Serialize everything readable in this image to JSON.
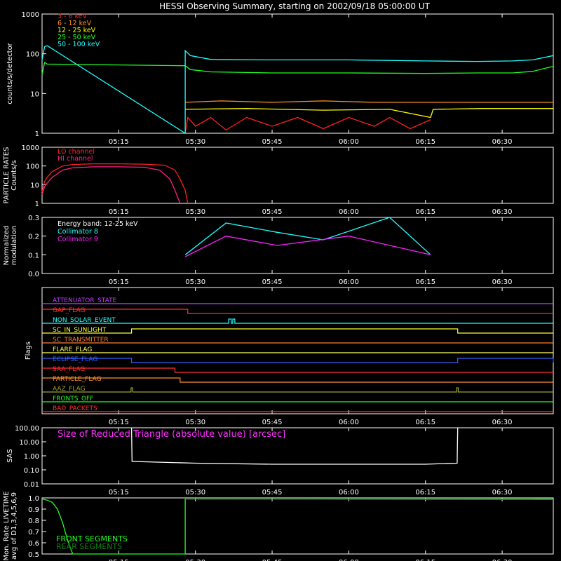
{
  "title": "HESSI Observing Summary, starting on 2002/09/18 05:00:00 UT",
  "time_axis": {
    "start_min": 0,
    "end_min": 100,
    "ticks": [
      {
        "t": 15,
        "label": "05:15"
      },
      {
        "t": 30,
        "label": "05:30"
      },
      {
        "t": 45,
        "label": "05:45"
      },
      {
        "t": 60,
        "label": "06:00"
      },
      {
        "t": 75,
        "label": "06:15"
      },
      {
        "t": 90,
        "label": "06:30"
      }
    ]
  },
  "chart_data": [
    {
      "type": "line",
      "id": "counts",
      "ylabel": "counts/s/detector",
      "yscale": "log",
      "ylim": [
        1,
        1000
      ],
      "yticks": [
        {
          "v": 1,
          "label": "1"
        },
        {
          "v": 10,
          "label": "10"
        },
        {
          "v": 100,
          "label": "100"
        },
        {
          "v": 1000,
          "label": "1000"
        }
      ],
      "series": [
        {
          "name": "3 - 6 keV",
          "color": "#ff2020",
          "points": [
            [
              28,
              1
            ],
            [
              28.5,
              2.5
            ],
            [
              30,
              1.5
            ],
            [
              33,
              2.5
            ],
            [
              36,
              1.2
            ],
            [
              40,
              2.5
            ],
            [
              45,
              1.5
            ],
            [
              50,
              2.5
            ],
            [
              55,
              1.3
            ],
            [
              60,
              2.5
            ],
            [
              65,
              1.5
            ],
            [
              68,
              2.5
            ],
            [
              72,
              1.3
            ],
            [
              76,
              2.2
            ]
          ]
        },
        {
          "name": "6 - 12 keV",
          "color": "#ff9020",
          "points": [
            [
              28,
              6
            ],
            [
              35,
              6.5
            ],
            [
              45,
              6
            ],
            [
              55,
              6.5
            ],
            [
              65,
              6
            ],
            [
              72,
              6
            ],
            [
              86,
              6
            ],
            [
              100,
              6
            ]
          ]
        },
        {
          "name": "12 - 25 keV",
          "color": "#ffff00",
          "points": [
            [
              28,
              4
            ],
            [
              40,
              4.2
            ],
            [
              55,
              3.8
            ],
            [
              68,
              4
            ],
            [
              76,
              2.5
            ],
            [
              76.5,
              4
            ],
            [
              86,
              4.2
            ],
            [
              100,
              4.2
            ]
          ]
        },
        {
          "name": "25 - 50 keV",
          "color": "#20ff20",
          "points": [
            [
              0,
              30
            ],
            [
              0.5,
              60
            ],
            [
              1,
              55
            ],
            [
              28,
              50
            ],
            [
              29,
              40
            ],
            [
              33,
              35
            ],
            [
              45,
              33
            ],
            [
              60,
              33
            ],
            [
              75,
              32
            ],
            [
              85,
              33
            ],
            [
              92,
              33
            ],
            [
              96,
              36
            ],
            [
              99,
              45
            ],
            [
              100,
              48
            ]
          ]
        },
        {
          "name": "50 - 100 keV",
          "color": "#20ffff",
          "points": [
            [
              0,
              70
            ],
            [
              0.5,
              150
            ],
            [
              1,
              160
            ],
            [
              28,
              1
            ],
            [
              28,
              120
            ],
            [
              29,
              90
            ],
            [
              33,
              72
            ],
            [
              45,
              70
            ],
            [
              60,
              70
            ],
            [
              75,
              66
            ],
            [
              85,
              64
            ],
            [
              92,
              66
            ],
            [
              96,
              70
            ],
            [
              99,
              85
            ],
            [
              100,
              90
            ]
          ]
        }
      ]
    },
    {
      "type": "line",
      "id": "particle",
      "ylabel": "PARTICLE RATES",
      "ylabel2": "Counts/s",
      "yscale": "log",
      "ylim": [
        1,
        1000
      ],
      "yticks": [
        {
          "v": 1,
          "label": "1"
        },
        {
          "v": 10,
          "label": "10"
        },
        {
          "v": 100,
          "label": "100"
        },
        {
          "v": 1000,
          "label": "1000"
        }
      ],
      "series": [
        {
          "name": "LO channel",
          "color": "#ff2020",
          "points": [
            [
              0,
              4
            ],
            [
              0.5,
              15
            ],
            [
              1,
              25
            ],
            [
              2,
              50
            ],
            [
              4,
              100
            ],
            [
              6,
              120
            ],
            [
              10,
              130
            ],
            [
              15,
              130
            ],
            [
              20,
              125
            ],
            [
              24,
              110
            ],
            [
              26,
              60
            ],
            [
              27,
              20
            ],
            [
              28,
              5
            ],
            [
              28.5,
              1
            ]
          ]
        },
        {
          "name": "HI channel",
          "color": "#ff2080",
          "points": [
            [
              0,
              3
            ],
            [
              0.5,
              8
            ],
            [
              1,
              12
            ],
            [
              2,
              25
            ],
            [
              4,
              60
            ],
            [
              6,
              80
            ],
            [
              10,
              90
            ],
            [
              15,
              90
            ],
            [
              20,
              85
            ],
            [
              23,
              60
            ],
            [
              25,
              20
            ],
            [
              26,
              5
            ],
            [
              27,
              1
            ]
          ]
        }
      ]
    },
    {
      "type": "line",
      "id": "modulation",
      "ylabel": "Normalized",
      "ylabel2": "modulation",
      "yscale": "linear",
      "ylim": [
        0,
        0.3
      ],
      "yticks": [
        {
          "v": 0,
          "label": "0.0"
        },
        {
          "v": 0.1,
          "label": "0.1"
        },
        {
          "v": 0.2,
          "label": "0.2"
        },
        {
          "v": 0.3,
          "label": "0.3"
        }
      ],
      "note": "Energy band: 12-25 keV",
      "series": [
        {
          "name": "Collimator 8",
          "color": "#20ffff",
          "points": [
            [
              28,
              0.1
            ],
            [
              36,
              0.27
            ],
            [
              46,
              0.22
            ],
            [
              55,
              0.18
            ],
            [
              68,
              0.3
            ],
            [
              76,
              0.1
            ]
          ]
        },
        {
          "name": "Collimator 9",
          "color": "#ff20ff",
          "points": [
            [
              28,
              0.09
            ],
            [
              36,
              0.2
            ],
            [
              46,
              0.15
            ],
            [
              60,
              0.2
            ],
            [
              76,
              0.1
            ]
          ]
        }
      ]
    },
    {
      "type": "line",
      "id": "sas",
      "ylabel": "SAS",
      "yscale": "log",
      "ylim": [
        0.01,
        100
      ],
      "yticks": [
        {
          "v": 0.01,
          "label": "0.01"
        },
        {
          "v": 0.1,
          "label": "0.10"
        },
        {
          "v": 1,
          "label": "1.00"
        },
        {
          "v": 10,
          "label": "10.00"
        },
        {
          "v": 100,
          "label": "100.00"
        }
      ],
      "note": "Size of Reduced Triangle (absolute value) [arcsec]",
      "series": [
        {
          "name": "",
          "color": "#ffffff",
          "points": [
            [
              17.5,
              100
            ],
            [
              17.6,
              0.4
            ],
            [
              30,
              0.3
            ],
            [
              45,
              0.25
            ],
            [
              60,
              0.25
            ],
            [
              75,
              0.25
            ],
            [
              81.2,
              0.3
            ],
            [
              81.3,
              100
            ]
          ]
        }
      ]
    },
    {
      "type": "line",
      "id": "livetime",
      "ylabel": "Mon. Rate LIVETIME",
      "ylabel2": "avg of D1,3,4,5,6,9",
      "yscale": "linear",
      "ylim": [
        0.5,
        1.0
      ],
      "yticks": [
        {
          "v": 0.5,
          "label": "0.5"
        },
        {
          "v": 0.6,
          "label": "0.6"
        },
        {
          "v": 0.7,
          "label": "0.7"
        },
        {
          "v": 0.8,
          "label": "0.8"
        },
        {
          "v": 0.9,
          "label": "0.9"
        },
        {
          "v": 1.0,
          "label": "1.0"
        }
      ],
      "series": [
        {
          "name": "FRONT SEGMENTS",
          "color": "#20ff20",
          "points": [
            [
              0,
              0.99
            ],
            [
              1,
              0.98
            ],
            [
              2,
              0.96
            ],
            [
              3,
              0.9
            ],
            [
              4,
              0.78
            ],
            [
              5,
              0.62
            ],
            [
              6,
              0.5
            ],
            [
              28,
              0.5
            ],
            [
              28,
              0.99
            ],
            [
              100,
              0.99
            ]
          ]
        },
        {
          "name": "REAR SEGMENTS",
          "color": "#108010",
          "points": [
            [
              28,
              0.99
            ],
            [
              100,
              0.985
            ]
          ]
        }
      ]
    }
  ],
  "flags": {
    "ylabel": "Flags",
    "rows": [
      {
        "name": "ATTENUATOR_STATE",
        "color": "#c040ff",
        "segments": []
      },
      {
        "name": "GAP_FLAG",
        "color": "#ff3030",
        "segments": [
          [
            0,
            28.5
          ]
        ]
      },
      {
        "name": "NON_SOLAR_EVENT",
        "color": "#20ffff",
        "segments": [
          [
            36.5,
            37
          ],
          [
            37.3,
            37.7
          ]
        ]
      },
      {
        "name": "SC_IN_SUNLIGHT",
        "color": "#ffff30",
        "segments": [
          [
            17.5,
            81.3
          ]
        ]
      },
      {
        "name": "SC_TRANSMITTER",
        "color": "#ff8030",
        "segments": []
      },
      {
        "name": "FLARE_FLAG",
        "color": "#ffff60",
        "segments": []
      },
      {
        "name": "ECLIPSE_FLAG",
        "color": "#3060ff",
        "segments": [
          [
            0,
            17.5
          ],
          [
            81.3,
            100
          ]
        ]
      },
      {
        "name": "SAA_FLAG",
        "color": "#ff3030",
        "segments": [
          [
            0,
            26
          ]
        ]
      },
      {
        "name": "PARTICLE_FLAG",
        "color": "#ff9030",
        "segments": [
          [
            0,
            27
          ]
        ]
      },
      {
        "name": "AAZ_FLAG",
        "color": "#a0a030",
        "segments": [
          [
            17.4,
            17.7
          ],
          [
            81.1,
            81.4
          ]
        ]
      },
      {
        "name": "FRONTS_OFF",
        "color": "#20ff20",
        "segments": []
      },
      {
        "name": "BAD_PACKETS",
        "color": "#ff3030",
        "segments": []
      }
    ]
  }
}
